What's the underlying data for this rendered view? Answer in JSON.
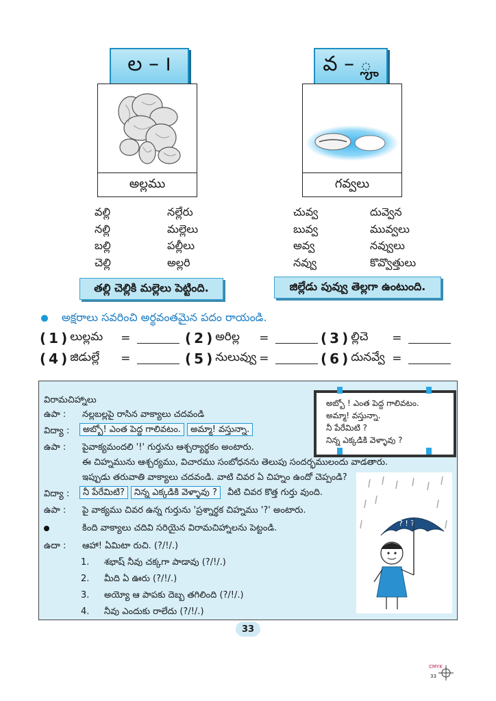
{
  "cards": [
    {
      "letters": "ల – ౹",
      "caption": "అల్లము",
      "words_left": [
        "వల్లి",
        "నల్లి",
        "బల్లి",
        "చెల్లి"
      ],
      "words_right": [
        "నల్లేరు",
        "మల్లెలు",
        "పల్లీలు",
        "అల్లరి"
      ],
      "sentence": "తల్లి చెల్లికి మల్లెలు పెట్టింది."
    },
    {
      "letters": "వ – ౣ",
      "caption": "గవ్వలు",
      "words_left": [
        "చువ్వ",
        "బువ్వ",
        "అవ్వ",
        "నవ్వు"
      ],
      "words_right": [
        "దువ్వెన",
        "మువ్వలు",
        "నవ్వులు",
        "కొవ్వొత్తులు"
      ],
      "sentence": "జిల్లేడు పువ్వు తెల్లగా ఉంటుంది."
    }
  ],
  "exercise": {
    "instruction": "అక్షరాలు సవరించి అర్థవంతమైన పదం రాయండి.",
    "items": [
      {
        "num": "1",
        "text": "లుల్లమ",
        "eq": "="
      },
      {
        "num": "2",
        "text": "అరిల్ల",
        "eq": "="
      },
      {
        "num": "3",
        "text": "ల్లిచె",
        "eq": "="
      },
      {
        "num": "4",
        "text": "జిడుల్లే",
        "eq": "="
      },
      {
        "num": "5",
        "text": "నులువ్వు",
        "eq": "="
      },
      {
        "num": "6",
        "text": "దునవ్వే",
        "eq": "="
      }
    ]
  },
  "panel": {
    "heading": "విరామచిహ్నాలు",
    "l1_label": "ఉపా  :",
    "l1_text": "నల్లబల్లపై రాసిన వాక్యాలు చదవండి",
    "l2_label": "విద్యా :",
    "l2_box1": "అబ్బో! ఎంత పెద్ద గాలివటం.",
    "l2_box2": "అమ్మా! వస్తున్నా.",
    "l3_label": "ఉపా  :",
    "l3_text": "పైవాక్యమందలి '!' గుర్తును ఆశ్చర్యార్థకం అంటారు.",
    "l4_text": "ఈ చిహ్నమును ఆశ్చర్యము, విచారము సంబోధనను తెలుపు సందర్భములందు వాడతారు.",
    "l5_text": "ఇప్పుడు తరువాతి వాక్యాలు చదవండి. వాటి చివర ఏ చిహ్నం ఉందో చెప్పండి?",
    "l6_label": "విద్యా :",
    "l6_box1": "నీ పేరేమిటి?",
    "l6_box2": "నిన్న ఎక్కడికి వెళ్ళావు ?",
    "l6_text": "వీటి చివర కొత్త గుర్తు వుంది.",
    "l7_label": "ఉపా  :",
    "l7_text": "పై వాక్యము చివర ఉన్న గుర్తును 'ప్రశ్నార్థక చిహ్నము '?' అంటారు.",
    "l8_text": "కింది వాక్యాలు చదివి సరియైన విరామచిహ్నాలను పెట్టండి.",
    "eg_label": "ఉదా :",
    "eg_text": "ఆహా! ఏమిటా రుచి. (?/!/.)",
    "items": [
      {
        "num": "1.",
        "text": "శభాష్ నీవు చక్కగా పాడావు (?/!/.)"
      },
      {
        "num": "2.",
        "text": "మీది ఏ ఊరు (?/!/.)"
      },
      {
        "num": "3.",
        "text": "అయ్యో ఆ పాపకు దెబ్బ తగిలింది (?/!/.)"
      },
      {
        "num": "4.",
        "text": "నీవు ఎందుకు రాలేదు (?/!/.)"
      }
    ],
    "board": [
      "అబ్బో ! ఎంత పెద్ద గాలివటం.",
      "అమ్మా! వస్తున్నా.",
      "నీ పేరేమిటి ?",
      "నిన్న ఎక్కడికి వెళ్ళావు ?"
    ]
  },
  "page_number": "33",
  "footer_tag": "CMYK",
  "footer_num": "33"
}
